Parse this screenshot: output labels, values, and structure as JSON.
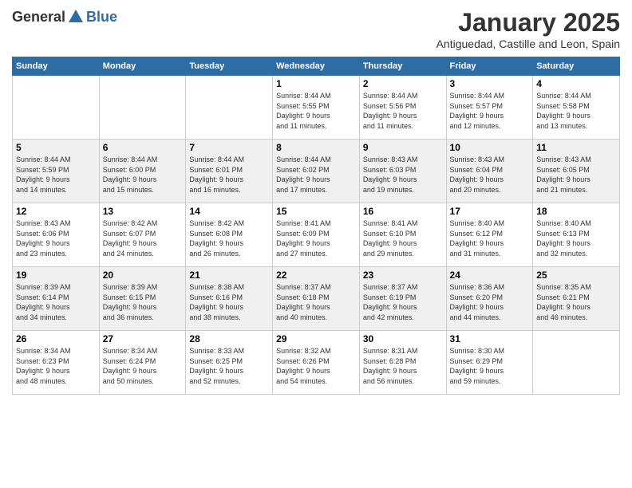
{
  "logo": {
    "general": "General",
    "blue": "Blue"
  },
  "header": {
    "month": "January 2025",
    "location": "Antiguedad, Castille and Leon, Spain"
  },
  "weekdays": [
    "Sunday",
    "Monday",
    "Tuesday",
    "Wednesday",
    "Thursday",
    "Friday",
    "Saturday"
  ],
  "weeks": [
    [
      {
        "day": "",
        "info": ""
      },
      {
        "day": "",
        "info": ""
      },
      {
        "day": "",
        "info": ""
      },
      {
        "day": "1",
        "info": "Sunrise: 8:44 AM\nSunset: 5:55 PM\nDaylight: 9 hours\nand 11 minutes."
      },
      {
        "day": "2",
        "info": "Sunrise: 8:44 AM\nSunset: 5:56 PM\nDaylight: 9 hours\nand 11 minutes."
      },
      {
        "day": "3",
        "info": "Sunrise: 8:44 AM\nSunset: 5:57 PM\nDaylight: 9 hours\nand 12 minutes."
      },
      {
        "day": "4",
        "info": "Sunrise: 8:44 AM\nSunset: 5:58 PM\nDaylight: 9 hours\nand 13 minutes."
      }
    ],
    [
      {
        "day": "5",
        "info": "Sunrise: 8:44 AM\nSunset: 5:59 PM\nDaylight: 9 hours\nand 14 minutes."
      },
      {
        "day": "6",
        "info": "Sunrise: 8:44 AM\nSunset: 6:00 PM\nDaylight: 9 hours\nand 15 minutes."
      },
      {
        "day": "7",
        "info": "Sunrise: 8:44 AM\nSunset: 6:01 PM\nDaylight: 9 hours\nand 16 minutes."
      },
      {
        "day": "8",
        "info": "Sunrise: 8:44 AM\nSunset: 6:02 PM\nDaylight: 9 hours\nand 17 minutes."
      },
      {
        "day": "9",
        "info": "Sunrise: 8:43 AM\nSunset: 6:03 PM\nDaylight: 9 hours\nand 19 minutes."
      },
      {
        "day": "10",
        "info": "Sunrise: 8:43 AM\nSunset: 6:04 PM\nDaylight: 9 hours\nand 20 minutes."
      },
      {
        "day": "11",
        "info": "Sunrise: 8:43 AM\nSunset: 6:05 PM\nDaylight: 9 hours\nand 21 minutes."
      }
    ],
    [
      {
        "day": "12",
        "info": "Sunrise: 8:43 AM\nSunset: 6:06 PM\nDaylight: 9 hours\nand 23 minutes."
      },
      {
        "day": "13",
        "info": "Sunrise: 8:42 AM\nSunset: 6:07 PM\nDaylight: 9 hours\nand 24 minutes."
      },
      {
        "day": "14",
        "info": "Sunrise: 8:42 AM\nSunset: 6:08 PM\nDaylight: 9 hours\nand 26 minutes."
      },
      {
        "day": "15",
        "info": "Sunrise: 8:41 AM\nSunset: 6:09 PM\nDaylight: 9 hours\nand 27 minutes."
      },
      {
        "day": "16",
        "info": "Sunrise: 8:41 AM\nSunset: 6:10 PM\nDaylight: 9 hours\nand 29 minutes."
      },
      {
        "day": "17",
        "info": "Sunrise: 8:40 AM\nSunset: 6:12 PM\nDaylight: 9 hours\nand 31 minutes."
      },
      {
        "day": "18",
        "info": "Sunrise: 8:40 AM\nSunset: 6:13 PM\nDaylight: 9 hours\nand 32 minutes."
      }
    ],
    [
      {
        "day": "19",
        "info": "Sunrise: 8:39 AM\nSunset: 6:14 PM\nDaylight: 9 hours\nand 34 minutes."
      },
      {
        "day": "20",
        "info": "Sunrise: 8:39 AM\nSunset: 6:15 PM\nDaylight: 9 hours\nand 36 minutes."
      },
      {
        "day": "21",
        "info": "Sunrise: 8:38 AM\nSunset: 6:16 PM\nDaylight: 9 hours\nand 38 minutes."
      },
      {
        "day": "22",
        "info": "Sunrise: 8:37 AM\nSunset: 6:18 PM\nDaylight: 9 hours\nand 40 minutes."
      },
      {
        "day": "23",
        "info": "Sunrise: 8:37 AM\nSunset: 6:19 PM\nDaylight: 9 hours\nand 42 minutes."
      },
      {
        "day": "24",
        "info": "Sunrise: 8:36 AM\nSunset: 6:20 PM\nDaylight: 9 hours\nand 44 minutes."
      },
      {
        "day": "25",
        "info": "Sunrise: 8:35 AM\nSunset: 6:21 PM\nDaylight: 9 hours\nand 46 minutes."
      }
    ],
    [
      {
        "day": "26",
        "info": "Sunrise: 8:34 AM\nSunset: 6:23 PM\nDaylight: 9 hours\nand 48 minutes."
      },
      {
        "day": "27",
        "info": "Sunrise: 8:34 AM\nSunset: 6:24 PM\nDaylight: 9 hours\nand 50 minutes."
      },
      {
        "day": "28",
        "info": "Sunrise: 8:33 AM\nSunset: 6:25 PM\nDaylight: 9 hours\nand 52 minutes."
      },
      {
        "day": "29",
        "info": "Sunrise: 8:32 AM\nSunset: 6:26 PM\nDaylight: 9 hours\nand 54 minutes."
      },
      {
        "day": "30",
        "info": "Sunrise: 8:31 AM\nSunset: 6:28 PM\nDaylight: 9 hours\nand 56 minutes."
      },
      {
        "day": "31",
        "info": "Sunrise: 8:30 AM\nSunset: 6:29 PM\nDaylight: 9 hours\nand 59 minutes."
      },
      {
        "day": "",
        "info": ""
      }
    ]
  ]
}
